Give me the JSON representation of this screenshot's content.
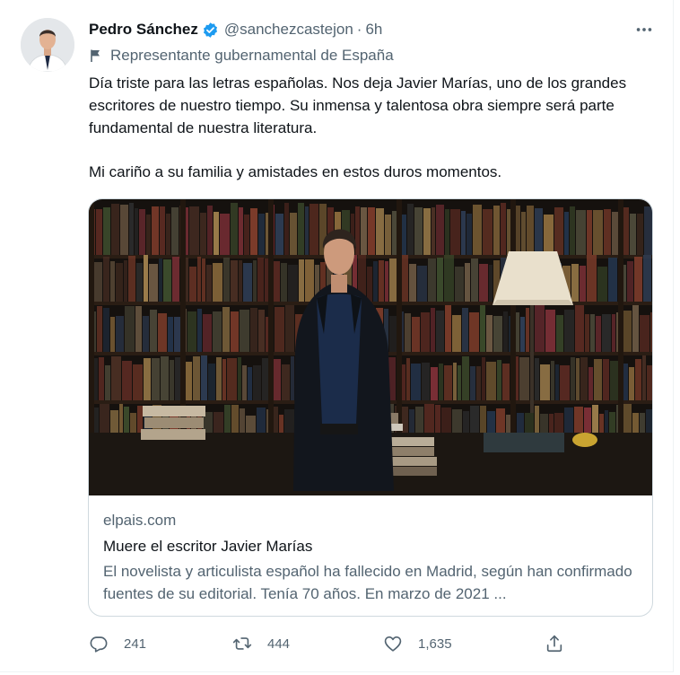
{
  "tweet": {
    "author": {
      "name": "Pedro Sánchez",
      "handle": "@sanchezcastejon",
      "separator": "·",
      "time": "6h",
      "verified_color": "#1d9bf0"
    },
    "label": "Representante gubernamental de España",
    "text": [
      "Día triste para las letras españolas. Nos deja Javier Marías, uno de los grandes escritores de nuestro tiempo. Su inmensa y talentosa obra siempre será parte fundamental de nuestra literatura.",
      "Mi cariño a su familia y amistades en estos duros momentos."
    ],
    "card": {
      "domain": "elpais.com",
      "title": "Muere el escritor Javier Marías",
      "description": "El novelista y articulista español ha fallecido en Madrid, según han confirmado fuentes de su editorial. Tenía 70 años. En marzo de 2021 ..."
    },
    "actions": {
      "replies": "241",
      "retweets": "444",
      "likes": "1,635"
    }
  },
  "icons": {
    "more": "more-horizontal-icon",
    "verified": "verified-badge-icon",
    "label": "flag-icon",
    "reply": "reply-icon",
    "retweet": "retweet-icon",
    "like": "heart-icon",
    "share": "share-icon"
  },
  "colors": {
    "text_primary": "#0f1419",
    "text_secondary": "#536471",
    "accent": "#1d9bf0",
    "border": "#cfd9de"
  }
}
